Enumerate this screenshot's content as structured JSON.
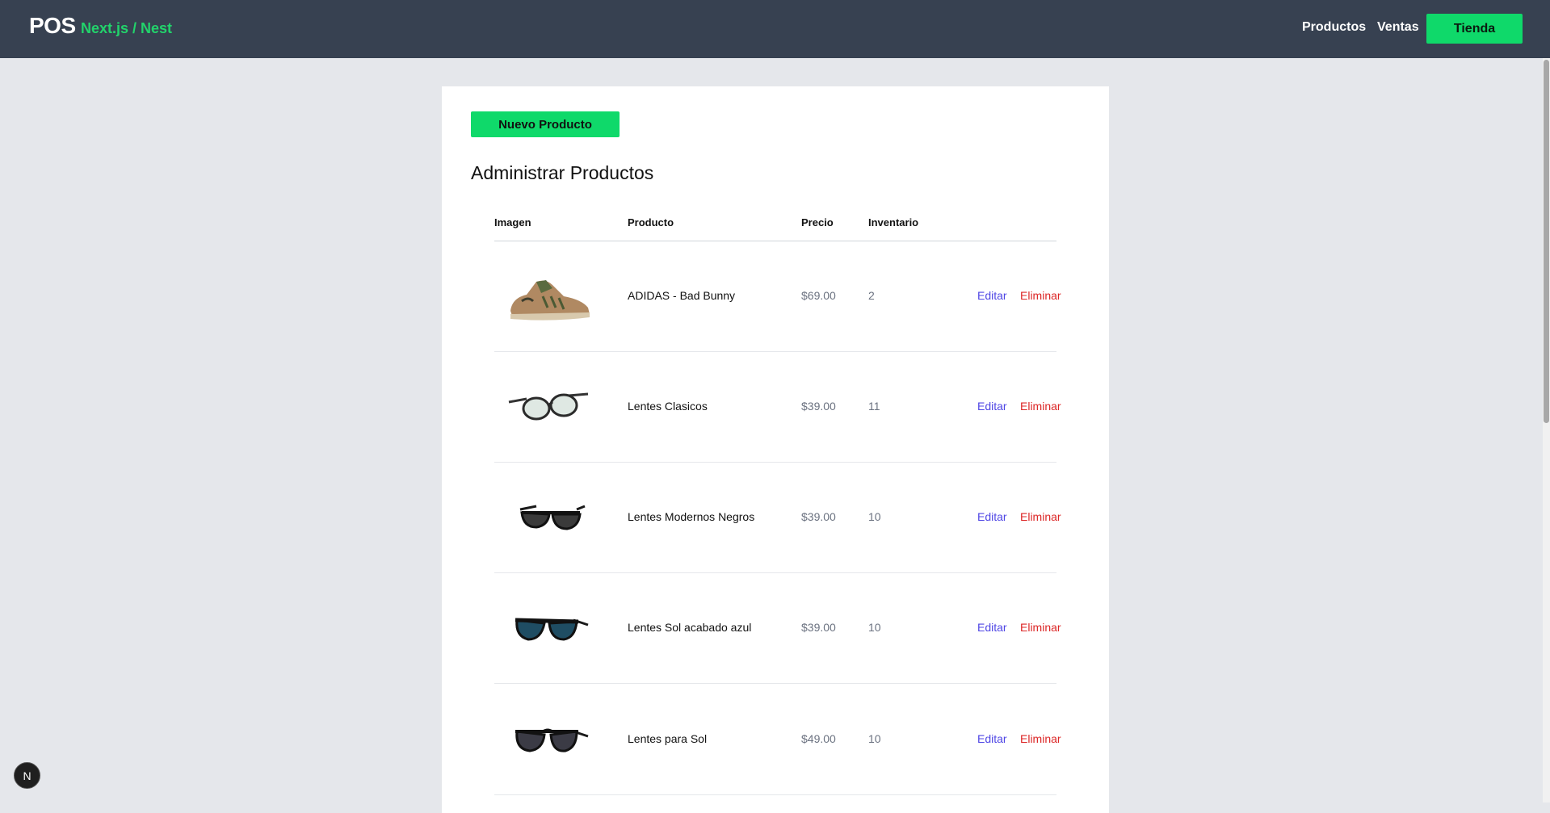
{
  "header": {
    "logo": "POS",
    "subtitle": "Next.js / Nest",
    "nav": {
      "productos": "Productos",
      "ventas": "Ventas",
      "tienda": "Tienda"
    }
  },
  "main": {
    "new_button": "Nuevo Producto",
    "title": "Administrar Productos",
    "table": {
      "headers": {
        "imagen": "Imagen",
        "producto": "Producto",
        "precio": "Precio",
        "inventario": "Inventario"
      },
      "rows": [
        {
          "name": "ADIDAS - Bad Bunny",
          "price": "$69.00",
          "stock": "2",
          "edit": "Editar",
          "delete": "Eliminar",
          "icon": "sneaker-image"
        },
        {
          "name": "Lentes Clasicos",
          "price": "$39.00",
          "stock": "11",
          "edit": "Editar",
          "delete": "Eliminar",
          "icon": "clear-glasses-image"
        },
        {
          "name": "Lentes Modernos Negros",
          "price": "$39.00",
          "stock": "10",
          "edit": "Editar",
          "delete": "Eliminar",
          "icon": "black-sunglasses-image"
        },
        {
          "name": "Lentes Sol acabado azul",
          "price": "$39.00",
          "stock": "10",
          "edit": "Editar",
          "delete": "Eliminar",
          "icon": "blue-sunglasses-image"
        },
        {
          "name": "Lentes para Sol",
          "price": "$49.00",
          "stock": "10",
          "edit": "Editar",
          "delete": "Eliminar",
          "icon": "aviator-sunglasses-image"
        }
      ]
    }
  },
  "dev_badge": "N",
  "colors": {
    "header_bg": "#374151",
    "accent": "#0fd96a",
    "edit": "#4f46e5",
    "delete": "#dc2626",
    "page_bg": "#e5e7eb"
  }
}
